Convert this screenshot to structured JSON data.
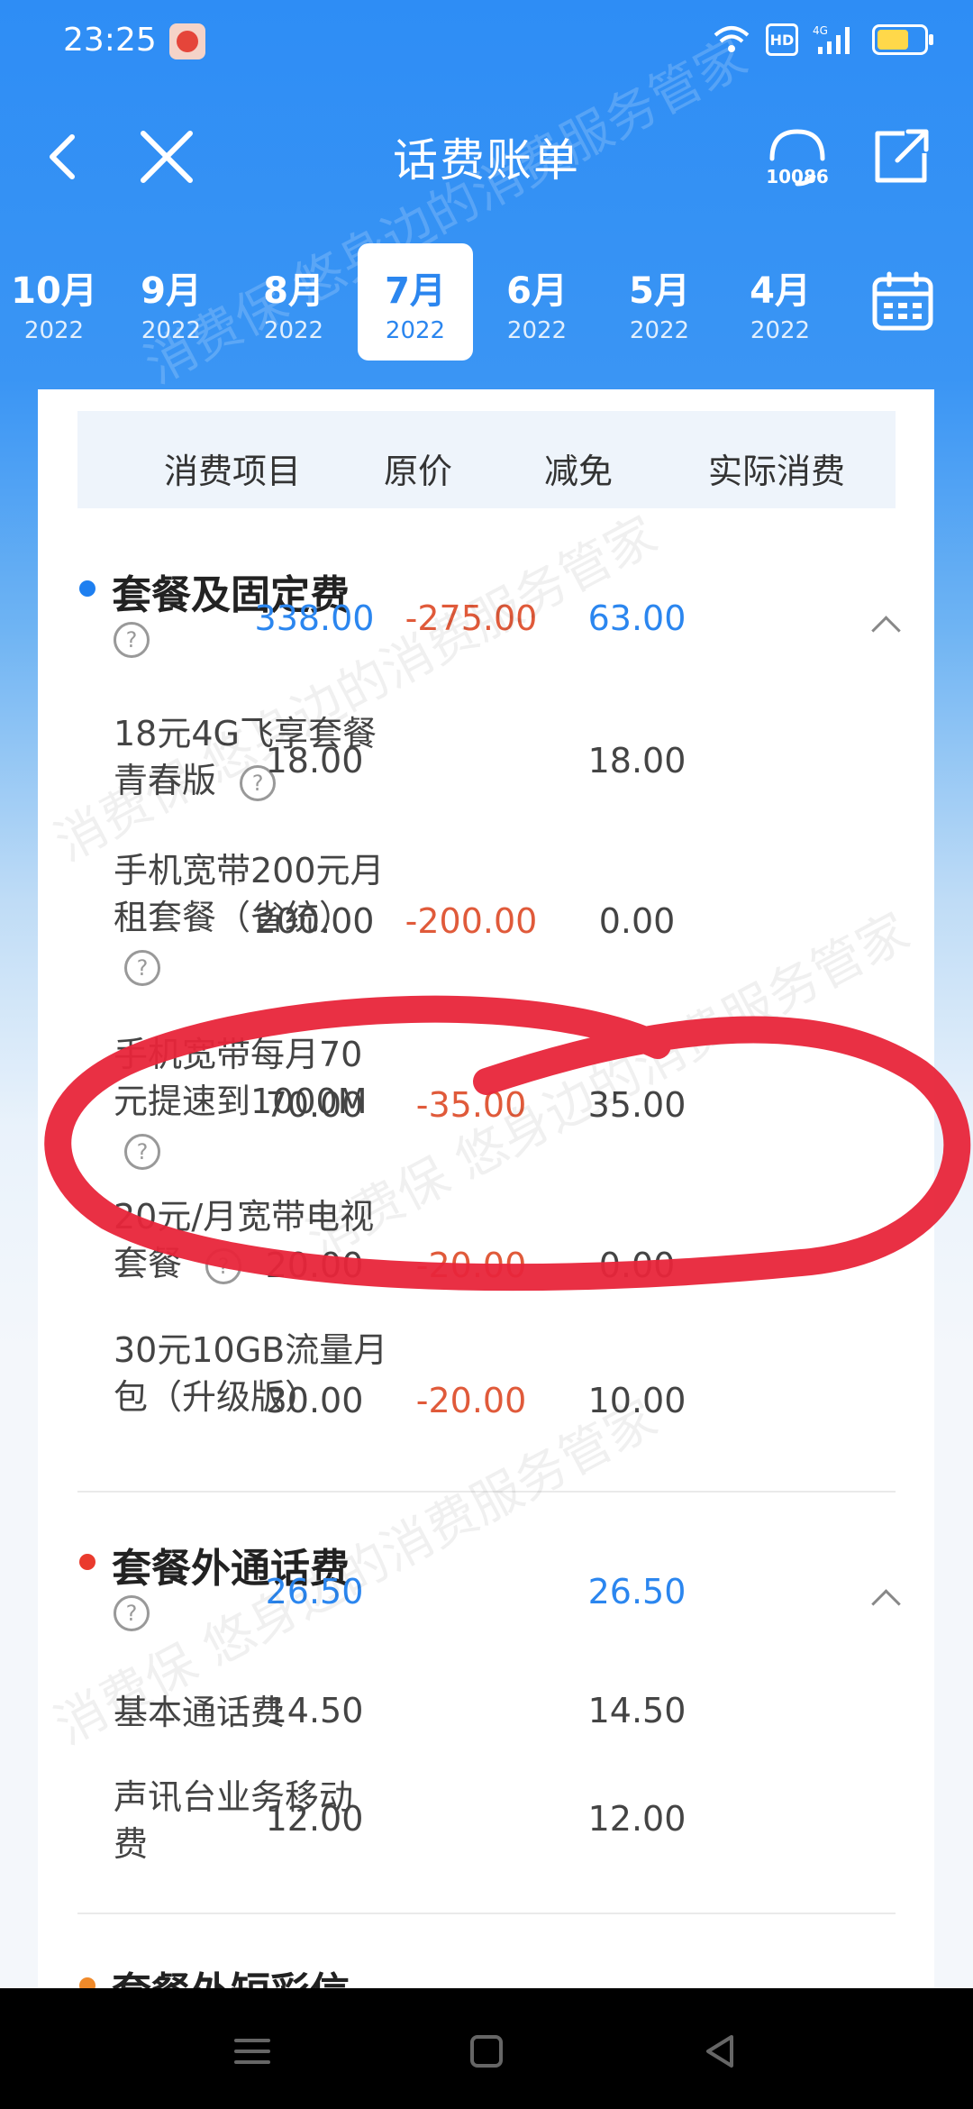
{
  "status": {
    "time": "23:25",
    "network": "4G",
    "hd": "HD"
  },
  "nav": {
    "title": "话费账单",
    "service_number": "10086"
  },
  "months": [
    {
      "m": "10月",
      "y": "2022"
    },
    {
      "m": "9月",
      "y": "2022"
    },
    {
      "m": "8月",
      "y": "2022"
    },
    {
      "m": "7月",
      "y": "2022",
      "selected": true
    },
    {
      "m": "6月",
      "y": "2022"
    },
    {
      "m": "5月",
      "y": "2022"
    },
    {
      "m": "4月",
      "y": "2022"
    }
  ],
  "table": {
    "headers": [
      "消费项目",
      "原价",
      "减免",
      "实际消费"
    ]
  },
  "sections": [
    {
      "title": "套餐及固定费",
      "dot_color": "#1e7ff0",
      "original": "338.00",
      "discount": "-275.00",
      "actual": "63.00",
      "items": [
        {
          "label_lines": [
            "18元4G飞享套餐",
            "青春版"
          ],
          "original": "18.00",
          "discount": "",
          "actual": "18.00"
        },
        {
          "label_lines": [
            "手机宽带200元月",
            "租套餐（省统）"
          ],
          "original": "200.00",
          "discount": "-200.00",
          "actual": "0.00"
        },
        {
          "label_lines": [
            "手机宽带每月70",
            "元提速到1000M"
          ],
          "original": "70.00",
          "discount": "-35.00",
          "actual": "35.00"
        },
        {
          "label_lines": [
            "20元/月宽带电视",
            "套餐"
          ],
          "original": "20.00",
          "discount": "-20.00",
          "actual": "0.00"
        },
        {
          "label_lines": [
            "30元10GB流量月",
            "包（升级版）"
          ],
          "original": "30.00",
          "discount": "-20.00",
          "actual": "10.00"
        }
      ]
    },
    {
      "title": "套餐外通话费",
      "dot_color": "#ea3b2e",
      "original": "26.50",
      "discount": "",
      "actual": "26.50",
      "items": [
        {
          "label_lines": [
            "基本通话费"
          ],
          "original": "14.50",
          "discount": "",
          "actual": "14.50"
        },
        {
          "label_lines": [
            "声讯台业务移动",
            "费"
          ],
          "original": "12.00",
          "discount": "",
          "actual": "12.00"
        }
      ]
    },
    {
      "title": "套餐外短彩信",
      "dot_color": "#f08a2a"
    }
  ],
  "watermark": "消费保 悠身边的消费服务管家",
  "colors": {
    "primary": "#2e8df5",
    "blue_value": "#2b86ef",
    "red_value": "#e05a3a",
    "annotation": "#e8253a"
  }
}
